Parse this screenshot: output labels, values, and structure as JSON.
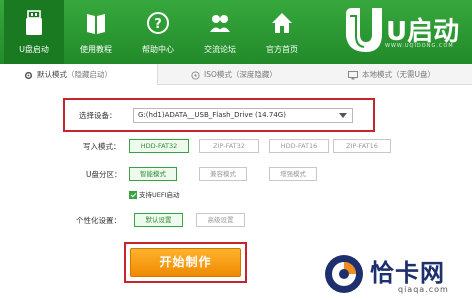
{
  "nav": {
    "items": [
      {
        "label": "U盘启动",
        "icon": "usb-drive-icon",
        "active": true
      },
      {
        "label": "使用教程",
        "icon": "book-icon"
      },
      {
        "label": "帮助中心",
        "icon": "help-icon"
      },
      {
        "label": "交流论坛",
        "icon": "people-icon"
      },
      {
        "label": "官方首页",
        "icon": "home-icon"
      }
    ]
  },
  "brand": {
    "logo_text": "U启动",
    "site": "WWW.UQIDONG.COM"
  },
  "tabs": [
    {
      "name": "默认模式",
      "sub": "（隐藏启动）",
      "icon": "gear-icon"
    },
    {
      "name": "ISO模式",
      "sub": "（深度隐藏）",
      "icon": "disc-icon"
    },
    {
      "name": "本地模式",
      "sub": "（无需U盘）",
      "icon": "monitor-icon"
    }
  ],
  "form": {
    "device_label": "选择设备：",
    "device_value": "G:(hd1)ADATA__USB_Flash_Drive (14.74G)",
    "write_label": "写入模式：",
    "write_options": [
      "HDD-FAT32",
      "ZIP-FAT32",
      "HDD-FAT16",
      "ZIP-FAT16"
    ],
    "partition_label": "U盘分区：",
    "partition_options": [
      "智能模式",
      "兼容模式",
      "增强模式"
    ],
    "uefi_label": "支持UEFI启动",
    "custom_label": "个性化设置：",
    "custom_options": [
      "默认设置",
      "高级设置"
    ]
  },
  "actions": {
    "start_label": "开始制作"
  },
  "watermark": {
    "text": "恰卡网",
    "url": "qiaqa.com"
  },
  "colors": {
    "nav_green": "#2a9a31",
    "highlight_red": "#c4262e",
    "start_orange": "#f59a10",
    "selected_green": "#39a33f"
  }
}
